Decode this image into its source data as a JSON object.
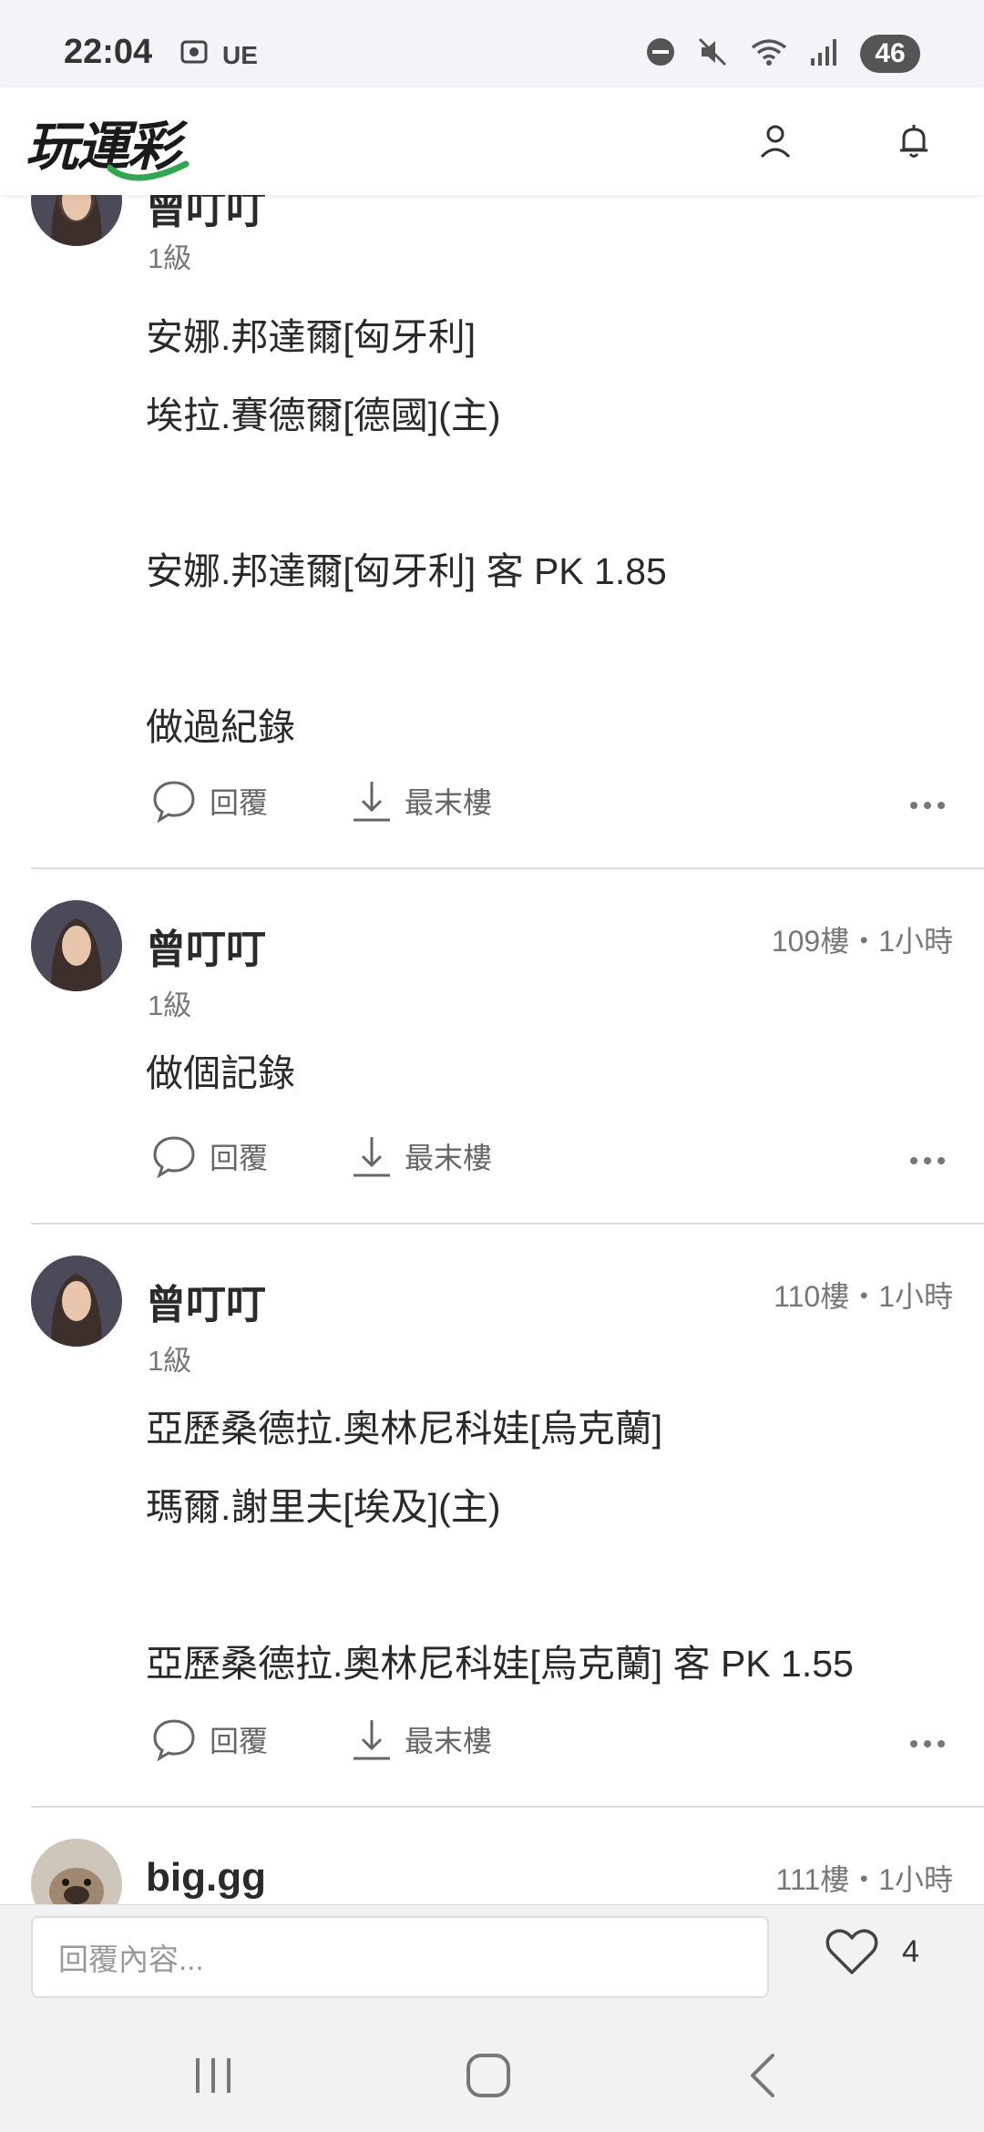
{
  "status_bar": {
    "time": "22:04",
    "carrier_tag": "UE",
    "battery": "46"
  },
  "header": {
    "logo_text": "玩運彩"
  },
  "posts": [
    {
      "username": "曾叮叮",
      "level": "1級",
      "meta": "",
      "lines": [
        "安娜.邦達爾[匈牙利]",
        "埃拉.賽德爾[德國](主)",
        "安娜.邦達爾[匈牙利] 客 PK 1.85",
        "做過紀錄"
      ],
      "reply_label": "回覆",
      "last_floor_label": "最末樓"
    },
    {
      "username": "曾叮叮",
      "level": "1級",
      "meta": "109樓・1小時",
      "lines": [
        "做個記錄"
      ],
      "reply_label": "回覆",
      "last_floor_label": "最末樓"
    },
    {
      "username": "曾叮叮",
      "level": "1級",
      "meta": "110樓・1小時",
      "lines": [
        "亞歷桑德拉.奧林尼科娃[烏克蘭]",
        "瑪爾.謝里夫[埃及](主)",
        "亞歷桑德拉.奧林尼科娃[烏克蘭] 客 PK 1.55"
      ],
      "reply_label": "回覆",
      "last_floor_label": "最末樓"
    },
    {
      "username": "big.gg",
      "meta": "111樓・1小時"
    }
  ],
  "reply_bar": {
    "placeholder": "回覆內容...",
    "like_count": "4"
  },
  "icons": {
    "user": "user-icon",
    "bell": "bell-icon",
    "comment": "comment-icon",
    "download": "download-icon",
    "more": "more-icon",
    "heart": "heart-icon"
  }
}
